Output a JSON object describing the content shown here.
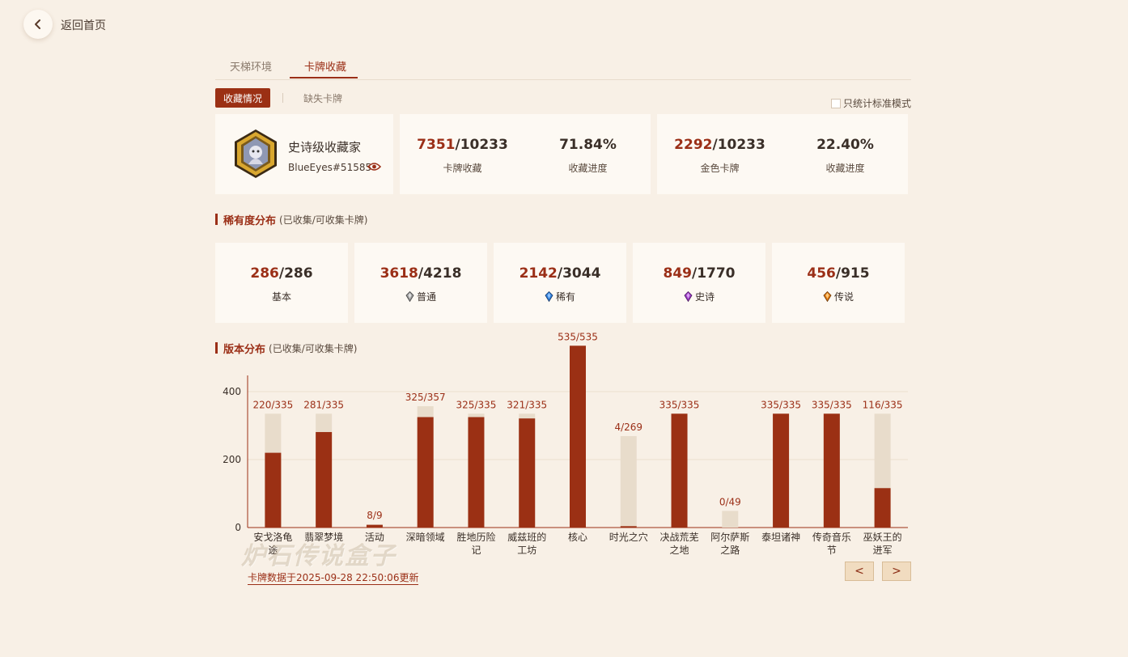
{
  "nav": {
    "back_label": "返回首页"
  },
  "tabs": [
    {
      "label": "天梯环境"
    },
    {
      "label": "卡牌收藏"
    }
  ],
  "subtabs": {
    "active": "收藏情况",
    "other": "缺失卡牌"
  },
  "standard_only": {
    "label": "只统计标准模式",
    "checked": false
  },
  "profile": {
    "rank_title": "史诗级收藏家",
    "battletag": "BlueEyes#51585"
  },
  "stats": {
    "collection": {
      "owned": "7351",
      "total": "/10233",
      "label": "卡牌收藏",
      "percent": "71.84%",
      "percent_label": "收藏进度"
    },
    "golden": {
      "owned": "2292",
      "total": "/10233",
      "label": "金色卡牌",
      "percent": "22.40%",
      "percent_label": "收藏进度"
    }
  },
  "rarity_section": {
    "title": "稀有度分布",
    "note": "(已收集/可收集卡牌)"
  },
  "rarity": [
    {
      "owned": "286",
      "total": "/286",
      "label": "基本",
      "icon": "none"
    },
    {
      "owned": "3618",
      "total": "/4218",
      "label": "普通",
      "icon": "gem-common-icon"
    },
    {
      "owned": "2142",
      "total": "/3044",
      "label": "稀有",
      "icon": "gem-rare-icon"
    },
    {
      "owned": "849",
      "total": "/1770",
      "label": "史诗",
      "icon": "gem-epic-icon"
    },
    {
      "owned": "456",
      "total": "/915",
      "label": "传说",
      "icon": "gem-legendary-icon"
    }
  ],
  "set_section": {
    "title": "版本分布",
    "note": "(已收集/可收集卡牌)"
  },
  "colors": {
    "accent": "#9b2f17",
    "bar_owned": "#9b3014",
    "bar_total": "#e8dccb",
    "gem_common": "#9a9a9a",
    "gem_rare": "#2f7fd8",
    "gem_epic": "#9a3bc2",
    "gem_legendary": "#e07b12"
  },
  "chart_data": {
    "type": "bar",
    "categories": [
      [
        "安戈洛龟",
        "途"
      ],
      [
        "翡翠梦境"
      ],
      [
        "活动"
      ],
      [
        "深暗领域"
      ],
      [
        "胜地历险",
        "记"
      ],
      [
        "威兹班的",
        "工坊"
      ],
      [
        "核心"
      ],
      [
        "时光之穴"
      ],
      [
        "决战荒芜",
        "之地"
      ],
      [
        "阿尔萨斯",
        "之路"
      ],
      [
        "泰坦诸神"
      ],
      [
        "传奇音乐",
        "节"
      ],
      [
        "巫妖王的",
        "进军"
      ]
    ],
    "series": [
      {
        "values": [
          220,
          281,
          8,
          325,
          325,
          321,
          535,
          4,
          335,
          0,
          335,
          335,
          116
        ]
      },
      {
        "values": [
          335,
          335,
          9,
          357,
          335,
          335,
          535,
          269,
          335,
          49,
          335,
          335,
          335
        ]
      }
    ],
    "value_labels": [
      "220/335",
      "281/335",
      "8/9",
      "325/357",
      "325/335",
      "321/335",
      "535/535",
      "4/269",
      "335/335",
      "0/49",
      "335/335",
      "335/335",
      "116/335"
    ],
    "yticks": [
      "0",
      "200",
      "400"
    ],
    "ylim": [
      0,
      400
    ],
    "grid": true
  },
  "footer": {
    "updated": "卡牌数据于2025-09-28 22:50:06更新",
    "watermark": "炉石传说盒子"
  },
  "pager": {
    "prev": "<",
    "next": ">"
  }
}
